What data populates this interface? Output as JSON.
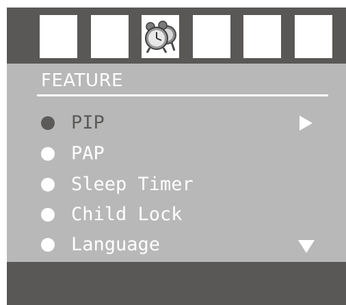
{
  "tabs": [
    {
      "icon": "blank-tab",
      "active": false
    },
    {
      "icon": "blank-tab",
      "active": false
    },
    {
      "icon": "alarm-clock-icon",
      "active": true
    },
    {
      "icon": "blank-tab",
      "active": false
    },
    {
      "icon": "blank-tab",
      "active": false
    },
    {
      "icon": "blank-tab",
      "active": false
    }
  ],
  "menu": {
    "title": "FEATURE",
    "items": [
      {
        "label": "PIP",
        "selected": true,
        "submenu": true
      },
      {
        "label": "PAP",
        "selected": false
      },
      {
        "label": "Sleep Timer",
        "selected": false
      },
      {
        "label": "Child Lock",
        "selected": false
      },
      {
        "label": "Language",
        "selected": false
      }
    ],
    "scroll_indicator": "down-arrow"
  },
  "colors": {
    "frame": "#5a5856",
    "panel": "#b8b8b8",
    "text": "#ffffff",
    "selected": "#5c5a58"
  }
}
